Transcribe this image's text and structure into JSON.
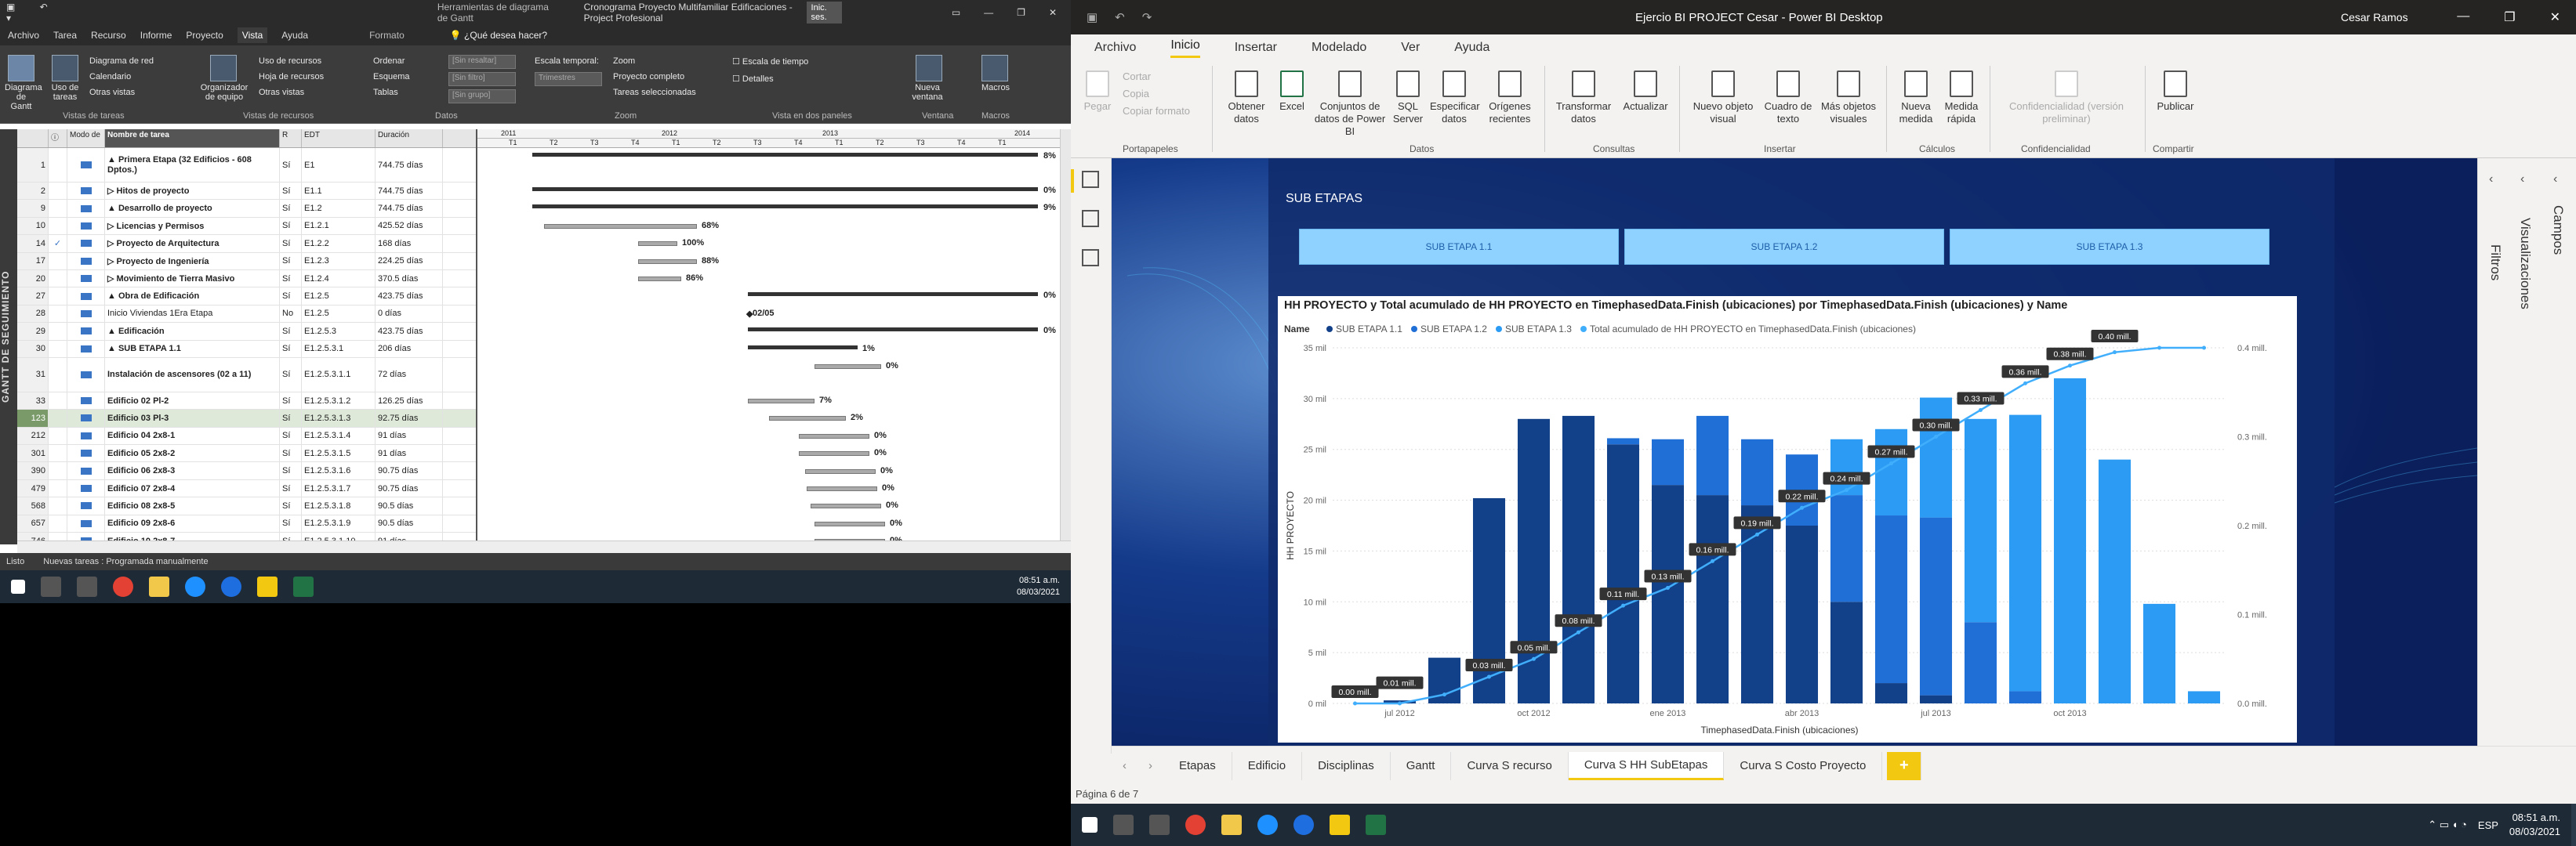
{
  "project": {
    "title_ctx": "Herramientas de diagrama de Gantt",
    "title": "Cronograma Proyecto Multifamiliar Edificaciones - Project Profesional",
    "account": "Inic. ses.",
    "menu": [
      "Archivo",
      "Tarea",
      "Recurso",
      "Informe",
      "Proyecto",
      "Vista",
      "Ayuda"
    ],
    "menu_active": "Vista",
    "format_tab": "Formato",
    "tell_me": "¿Qué desea hacer?",
    "ribbon": {
      "gantt_btn": "Diagrama de Gantt",
      "uso_tareas": "Uso de tareas",
      "red": "Diagrama de red",
      "calendario": "Calendario",
      "otras_vistas": "Otras vistas",
      "organizador": "Organizador de equipo",
      "uso_recursos": "Uso de recursos",
      "hoja_recursos": "Hoja de recursos",
      "otras_vistas2": "Otras vistas",
      "ordenar": "Ordenar",
      "esquema": "Esquema",
      "tablas": "Tablas",
      "resaltar": "[Sin resaltar]",
      "filtro": "[Sin filtro]",
      "grupo": "[Sin grupo]",
      "escala_label": "Escala temporal:",
      "escala_val": "Trimestres",
      "zoom": "Zoom",
      "proyecto_completo": "Proyecto completo",
      "tareas_sel": "Tareas seleccionadas",
      "escala_tiempo": "Escala de tiempo",
      "detalles": "Detalles",
      "nueva_ventana": "Nueva ventana",
      "macros": "Macros",
      "groups": [
        "Vistas de tareas",
        "Vistas de recursos",
        "Datos",
        "Zoom",
        "Vista en dos paneles",
        "Ventana",
        "Macros"
      ]
    },
    "sidebar_label": "GANTT DE SEGUIMIENTO",
    "columns": [
      "",
      "Modo de",
      "Nombre de tarea",
      "R",
      "EDT",
      "Duración"
    ],
    "rows": [
      {
        "id": "1",
        "name": "▲ Primera Etapa (32 Edificios - 608 Dptos.)",
        "r": "Sí",
        "edt": "E1",
        "dur": "744.75 días",
        "tall": true
      },
      {
        "id": "2",
        "name": "▷ Hitos de proyecto",
        "r": "Sí",
        "edt": "E1.1",
        "dur": "744.75 días"
      },
      {
        "id": "9",
        "name": "▲ Desarrollo de proyecto",
        "r": "Sí",
        "edt": "E1.2",
        "dur": "744.75 días"
      },
      {
        "id": "10",
        "name": "▷ Licencias y Permisos",
        "r": "Sí",
        "edt": "E1.2.1",
        "dur": "425.52 días"
      },
      {
        "id": "14",
        "name": "▷ Proyecto de Arquitectura",
        "r": "Sí",
        "edt": "E1.2.2",
        "dur": "168 días",
        "check": true
      },
      {
        "id": "17",
        "name": "▷ Proyecto de Ingeniería",
        "r": "Sí",
        "edt": "E1.2.3",
        "dur": "224.25 días"
      },
      {
        "id": "20",
        "name": "▷ Movimiento de Tierra Masivo",
        "r": "Sí",
        "edt": "E1.2.4",
        "dur": "370.5 días"
      },
      {
        "id": "27",
        "name": "▲ Obra de Edificación",
        "r": "Sí",
        "edt": "E1.2.5",
        "dur": "423.75 días"
      },
      {
        "id": "28",
        "name": "Inicio Viviendas 1Era Etapa",
        "r": "No",
        "edt": "E1.2.5",
        "dur": "0 días",
        "norm": true
      },
      {
        "id": "29",
        "name": "▲ Edificación",
        "r": "Sí",
        "edt": "E1.2.5.3",
        "dur": "423.75 días"
      },
      {
        "id": "30",
        "name": "▲ SUB ETAPA 1.1",
        "r": "Sí",
        "edt": "E1.2.5.3.1",
        "dur": "206 días"
      },
      {
        "id": "31",
        "name": "Instalación de ascensores (02 a 11)",
        "r": "Sí",
        "edt": "E1.2.5.3.1.1",
        "dur": "72 días",
        "tall": true
      },
      {
        "id": "33",
        "name": "Edificio 02 Pl-2",
        "r": "Sí",
        "edt": "E1.2.5.3.1.2",
        "dur": "126.25 días"
      },
      {
        "id": "123",
        "name": "Edificio 03 Pl-3",
        "r": "Sí",
        "edt": "E1.2.5.3.1.3",
        "dur": "92.75 días",
        "sel": true
      },
      {
        "id": "212",
        "name": "Edificio 04 2x8-1",
        "r": "Sí",
        "edt": "E1.2.5.3.1.4",
        "dur": "91 días"
      },
      {
        "id": "301",
        "name": "Edificio 05 2x8-2",
        "r": "Sí",
        "edt": "E1.2.5.3.1.5",
        "dur": "91 días"
      },
      {
        "id": "390",
        "name": "Edificio 06 2x8-3",
        "r": "Sí",
        "edt": "E1.2.5.3.1.6",
        "dur": "90.75 días"
      },
      {
        "id": "479",
        "name": "Edificio 07 2x8-4",
        "r": "Sí",
        "edt": "E1.2.5.3.1.7",
        "dur": "90.75 días"
      },
      {
        "id": "568",
        "name": "Edificio 08 2x8-5",
        "r": "Sí",
        "edt": "E1.2.5.3.1.8",
        "dur": "90.5 días"
      },
      {
        "id": "657",
        "name": "Edificio 09 2x8-6",
        "r": "Sí",
        "edt": "E1.2.5.3.1.9",
        "dur": "90.5 días"
      },
      {
        "id": "746",
        "name": "Edificio 10 2x8-7",
        "r": "Sí",
        "edt": "E1.2.5.3.1.10",
        "dur": "91 días"
      }
    ],
    "timescale_years": [
      "2011",
      "2012",
      "2013",
      "2014"
    ],
    "timescale_quarters": [
      "T1",
      "T2",
      "T3",
      "T4",
      "T1",
      "T2",
      "T3",
      "T4",
      "T1",
      "T2",
      "T3",
      "T4",
      "T1"
    ],
    "gantt_labels": [
      "8%",
      "0%",
      "9%",
      "68%",
      "100%",
      "88%",
      "86%",
      "0%",
      "02/05",
      "0%",
      "1%",
      "0%",
      "7%",
      "2%",
      "0%",
      "0%",
      "0%",
      "0%",
      "0%",
      "0%",
      "0%"
    ],
    "status_left": "Listo",
    "status_new_tasks": "Nuevas tareas : Programada manualmente",
    "clock_time": "08:51 a.m.",
    "clock_date": "08/03/2021"
  },
  "pbi": {
    "title": "Ejercio BI PROJECT Cesar - Power BI Desktop",
    "user": "Cesar Ramos",
    "tabs": [
      "Archivo",
      "Inicio",
      "Insertar",
      "Modelado",
      "Ver",
      "Ayuda"
    ],
    "tab_active": "Inicio",
    "ribbon": {
      "pegar": "Pegar",
      "cortar": "Cortar",
      "copia": "Copia",
      "copiar_formato": "Copiar formato",
      "obtener_datos": "Obtener datos",
      "excel": "Excel",
      "conjuntos": "Conjuntos de datos de Power BI",
      "sql": "SQL Server",
      "especificar": "Especificar datos",
      "origenes": "Orígenes recientes",
      "transformar": "Transformar datos",
      "actualizar": "Actualizar",
      "nuevo_objeto": "Nuevo objeto visual",
      "cuadro_texto": "Cuadro de texto",
      "mas_objetos": "Más objetos visuales",
      "nueva_medida": "Nueva medida",
      "medida_rapida": "Medida rápida",
      "confidencialidad_btn": "Confidencialidad (versión preliminar)",
      "publicar": "Publicar",
      "groups": [
        "Portapapeles",
        "Datos",
        "Consultas",
        "Insertar",
        "Cálculos",
        "Confidencialidad",
        "Compartir"
      ]
    },
    "right_pane": [
      "Campos",
      "Visualizaciones",
      "Filtros"
    ],
    "report_heading": "SUB ETAPAS",
    "slicers": [
      "SUB ETAPA 1.1",
      "SUB ETAPA 1.2",
      "SUB ETAPA 1.3"
    ],
    "chart_title": "HH PROYECTO y Total acumulado de HH PROYECTO en TimephasedData.Finish (ubicaciones) por TimephasedData.Finish (ubicaciones) y Name",
    "legend_label": "Name",
    "page_tabs": [
      "Etapas",
      "Edificio",
      "Disciplinas",
      "Gantt",
      "Curva S recurso",
      "Curva S HH SubEtapas",
      "Curva S Costo Proyecto"
    ],
    "page_tab_active": "Curva S HH SubEtapas",
    "status": "Página 6 de 7",
    "clock_time": "08:51 a.m.",
    "clock_date": "08/03/2021",
    "lang": "ESP"
  },
  "chart_data": {
    "type": "bar",
    "title": "HH PROYECTO y Total acumulado de HH PROYECTO en TimephasedData.Finish (ubicaciones) por TimephasedData.Finish (ubicaciones) y Name",
    "xlabel": "TimephasedData.Finish (ubicaciones)",
    "ylabel": "HH PROYECTO",
    "ylim": [
      0,
      35000
    ],
    "y2lim": [
      0,
      400000
    ],
    "yticks": [
      "0 mil",
      "5 mil",
      "10 mil",
      "15 mil",
      "20 mil",
      "25 mil",
      "30 mil",
      "35 mil"
    ],
    "y2ticks": [
      "0.0 mill.",
      "0.1 mill.",
      "0.2 mill.",
      "0.3 mill.",
      "0.4 mill."
    ],
    "xticks": [
      "jul 2012",
      "oct 2012",
      "ene 2013",
      "abr 2013",
      "jul 2013",
      "oct 2013"
    ],
    "colors": {
      "s11": "#12418a",
      "s12": "#1f6fd6",
      "s13": "#2b9bf4",
      "line": "#41aefc"
    },
    "series": [
      {
        "name": "SUB ETAPA 1.1",
        "values": [
          0,
          300,
          4500,
          20200,
          28000,
          28300,
          25500,
          21500,
          20500,
          19500,
          17500,
          10000,
          2000,
          800,
          0,
          0,
          0,
          0,
          0,
          0
        ]
      },
      {
        "name": "SUB ETAPA 1.2",
        "values": [
          0,
          0,
          0,
          0,
          0,
          0,
          600,
          4500,
          7800,
          6500,
          7000,
          10500,
          16500,
          17500,
          8000,
          1200,
          0,
          0,
          0,
          0
        ]
      },
      {
        "name": "SUB ETAPA 1.3",
        "values": [
          0,
          0,
          0,
          0,
          0,
          0,
          0,
          0,
          0,
          0,
          0,
          5500,
          8500,
          11800,
          20000,
          27200,
          32000,
          24000,
          9800,
          1200
        ]
      },
      {
        "name": "Total acumulado de HH PROYECTO en TimephasedData.Finish (ubicaciones)",
        "values": [
          0,
          0,
          10000,
          30000,
          50000,
          80000,
          110000,
          130000,
          160000,
          190000,
          220000,
          240000,
          270000,
          300000,
          330000,
          360000,
          380000,
          395000,
          400000,
          400000
        ]
      }
    ],
    "data_labels": [
      "0.00 mill.",
      "0.01 mill.",
      "0.03 mill.",
      "0.05 mill.",
      "0.08 mill.",
      "0.11 mill.",
      "0.13 mill.",
      "0.16 mill.",
      "0.19 mill.",
      "0.22 mill.",
      "0.24 mill.",
      "0.27 mill.",
      "0.30 mill.",
      "0.33 mill.",
      "0.36 mill.",
      "0.38 mill.",
      "0.40 mill."
    ],
    "legend_position": "top-left"
  }
}
